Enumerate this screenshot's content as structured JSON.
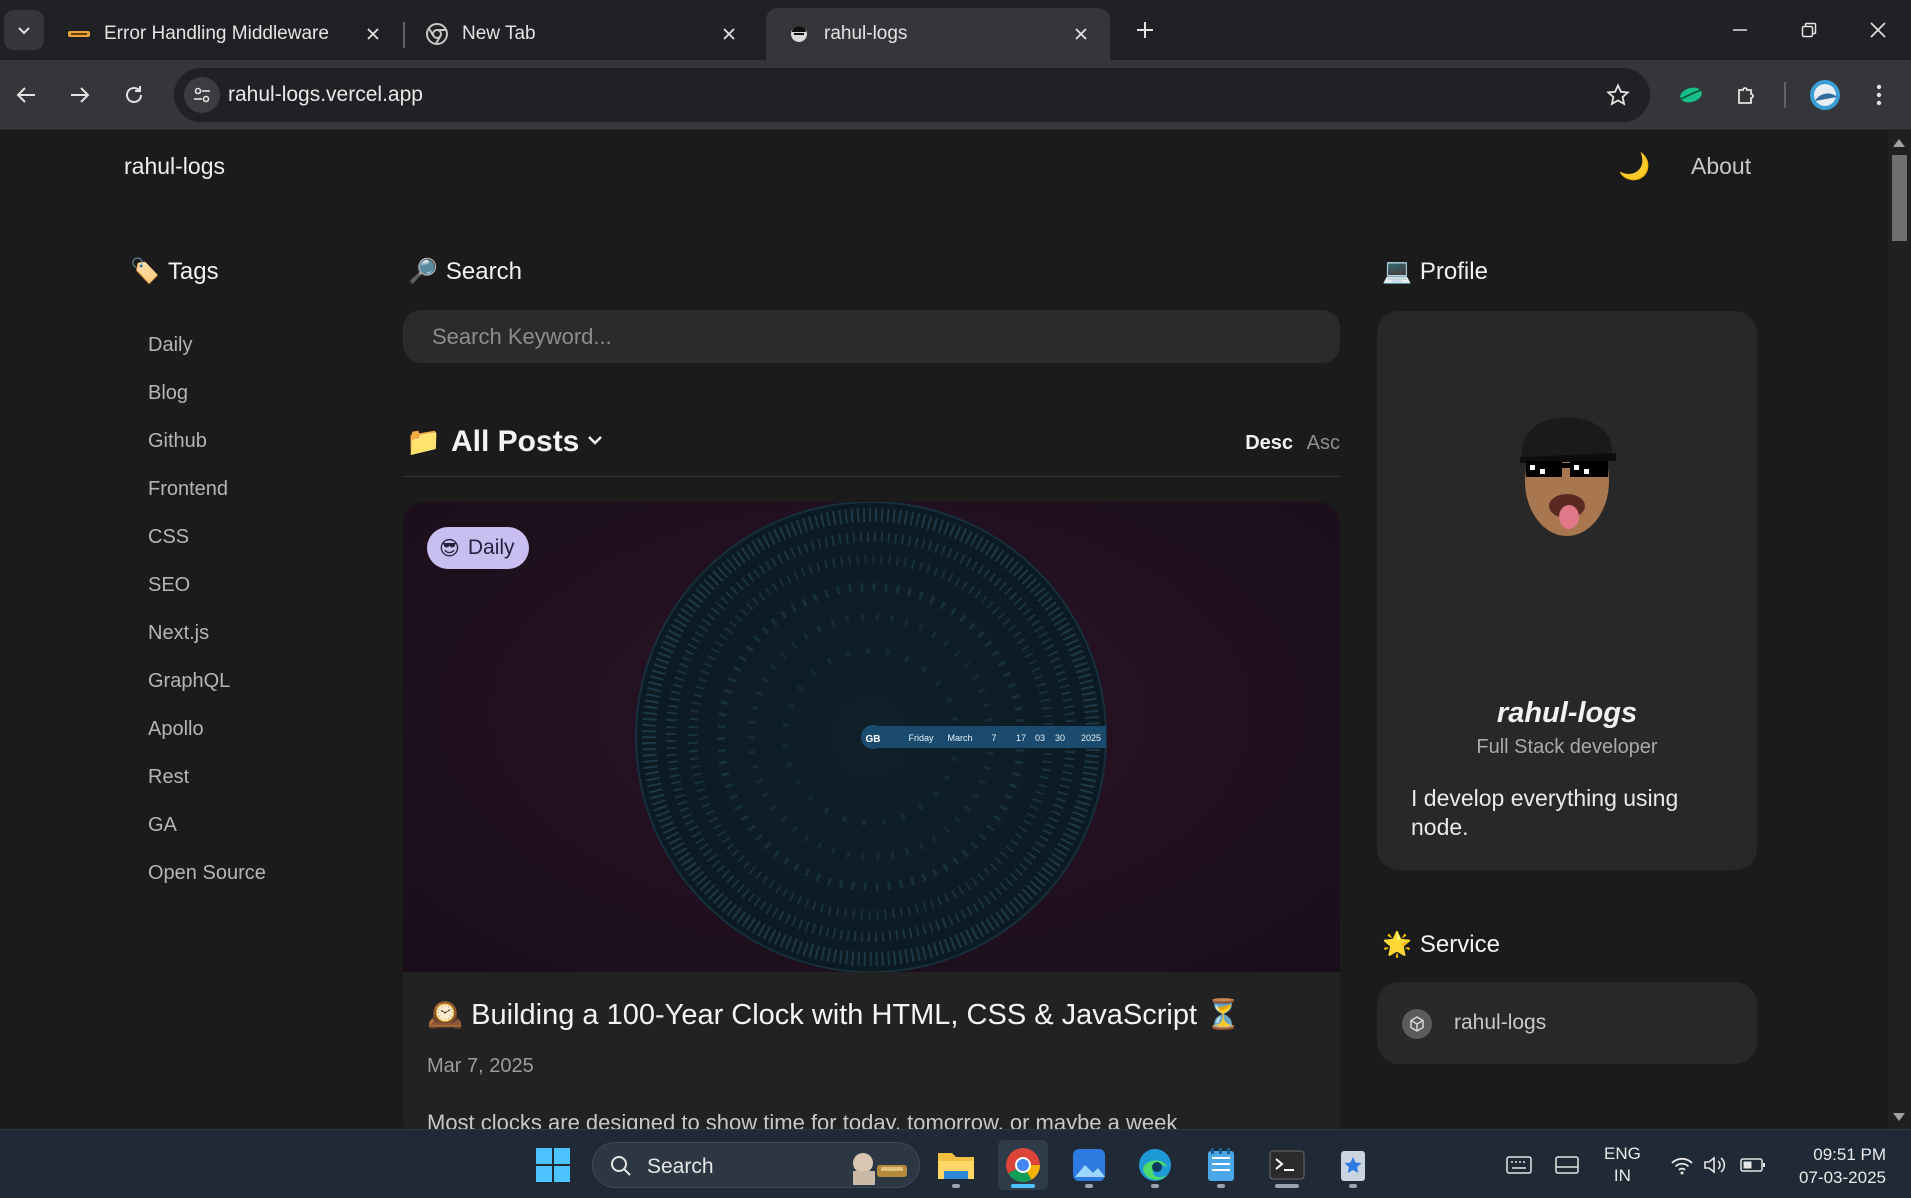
{
  "browser": {
    "tabs": [
      {
        "title": "Error Handling Middleware",
        "favicon": "logo-icon"
      },
      {
        "title": "New Tab",
        "favicon": "chrome-icon"
      },
      {
        "title": "rahul-logs",
        "favicon": "avatar-icon",
        "active": true
      }
    ],
    "url": "rahul-logs.vercel.app"
  },
  "site": {
    "brand": "rahul-logs",
    "theme_icon": "🌙",
    "nav_about": "About"
  },
  "tags": {
    "emoji": "🏷️",
    "title": "Tags",
    "items": [
      "Daily",
      "Blog",
      "Github",
      "Frontend",
      "CSS",
      "SEO",
      "Next.js",
      "GraphQL",
      "Apollo",
      "Rest",
      "GA",
      "Open Source"
    ]
  },
  "search": {
    "emoji": "🔎",
    "title": "Search",
    "placeholder": "Search Keyword..."
  },
  "posts": {
    "folder_emoji": "📁",
    "category": "All Posts",
    "sort_desc": "Desc",
    "sort_asc": "Asc",
    "items": [
      {
        "badge_emoji": "😎",
        "badge": "Daily",
        "title": "🕰️ Building a 100-Year Clock with HTML, CSS & JavaScript ⏳",
        "date": "Mar 7, 2025",
        "excerpt": "Most clocks are designed to show time for today, tomorrow, or maybe a week"
      }
    ],
    "clock_readout": {
      "region": "GB",
      "day": "Friday",
      "month": "March",
      "date": "7",
      "hour": "17",
      "minute": "03",
      "second": "30",
      "year": "2025"
    }
  },
  "profile": {
    "emoji": "💻",
    "title": "Profile",
    "name": "rahul-logs",
    "role": "Full Stack developer",
    "bio": "I develop everything using node."
  },
  "service": {
    "emoji": "🌟",
    "title": "Service",
    "item": "rahul-logs"
  },
  "taskbar": {
    "search_label": "Search",
    "lang_1": "ENG",
    "lang_2": "IN",
    "time": "09:51 PM",
    "date": "07-03-2025"
  },
  "colors": {
    "page_bg": "#1b1b1b",
    "card_bg": "#282828",
    "badge_bg": "#c8bff0",
    "clock_band": "#1a4a6e"
  }
}
